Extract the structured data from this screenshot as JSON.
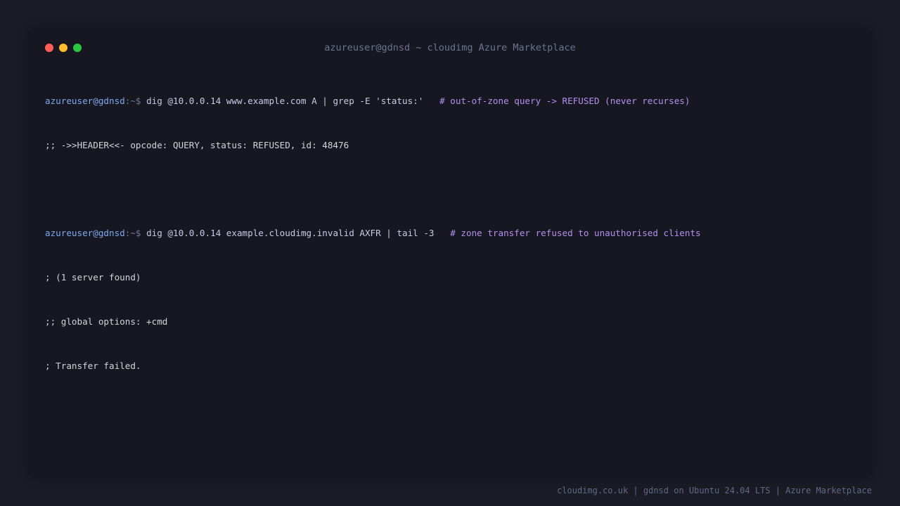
{
  "window": {
    "title": "azureuser@gdnsd ~ cloudimg Azure Marketplace",
    "traffic_lights": [
      {
        "name": "close",
        "color": "#ff5f57"
      },
      {
        "name": "minimize",
        "color": "#febc2e"
      },
      {
        "name": "maximize",
        "color": "#28c840"
      }
    ]
  },
  "terminal": {
    "prompt_user": "azureuser@gdnsd",
    "prompt_path": ":~$",
    "blocks": [
      {
        "command": "dig @10.0.0.14 www.example.com A | grep -E 'status:'",
        "comment": "# out-of-zone query -> REFUSED (never recurses)",
        "output": [
          ";; ->>HEADER<<- opcode: QUERY, status: REFUSED, id: 48476"
        ]
      },
      {
        "command": "dig @10.0.0.14 example.cloudimg.invalid AXFR | tail -3",
        "comment": "# zone transfer refused to unauthorised clients",
        "output": [
          "; (1 server found)",
          ";; global options: +cmd",
          "; Transfer failed."
        ]
      }
    ]
  },
  "footer": {
    "text": "cloudimg.co.uk | gdnsd on Ubuntu 24.04 LTS | Azure Marketplace"
  },
  "colors": {
    "background": "#1b1c26",
    "window": "#161720",
    "prompt_user": "#7ea8f0",
    "comment": "#b48ff0",
    "output": "#d2d4dc"
  }
}
